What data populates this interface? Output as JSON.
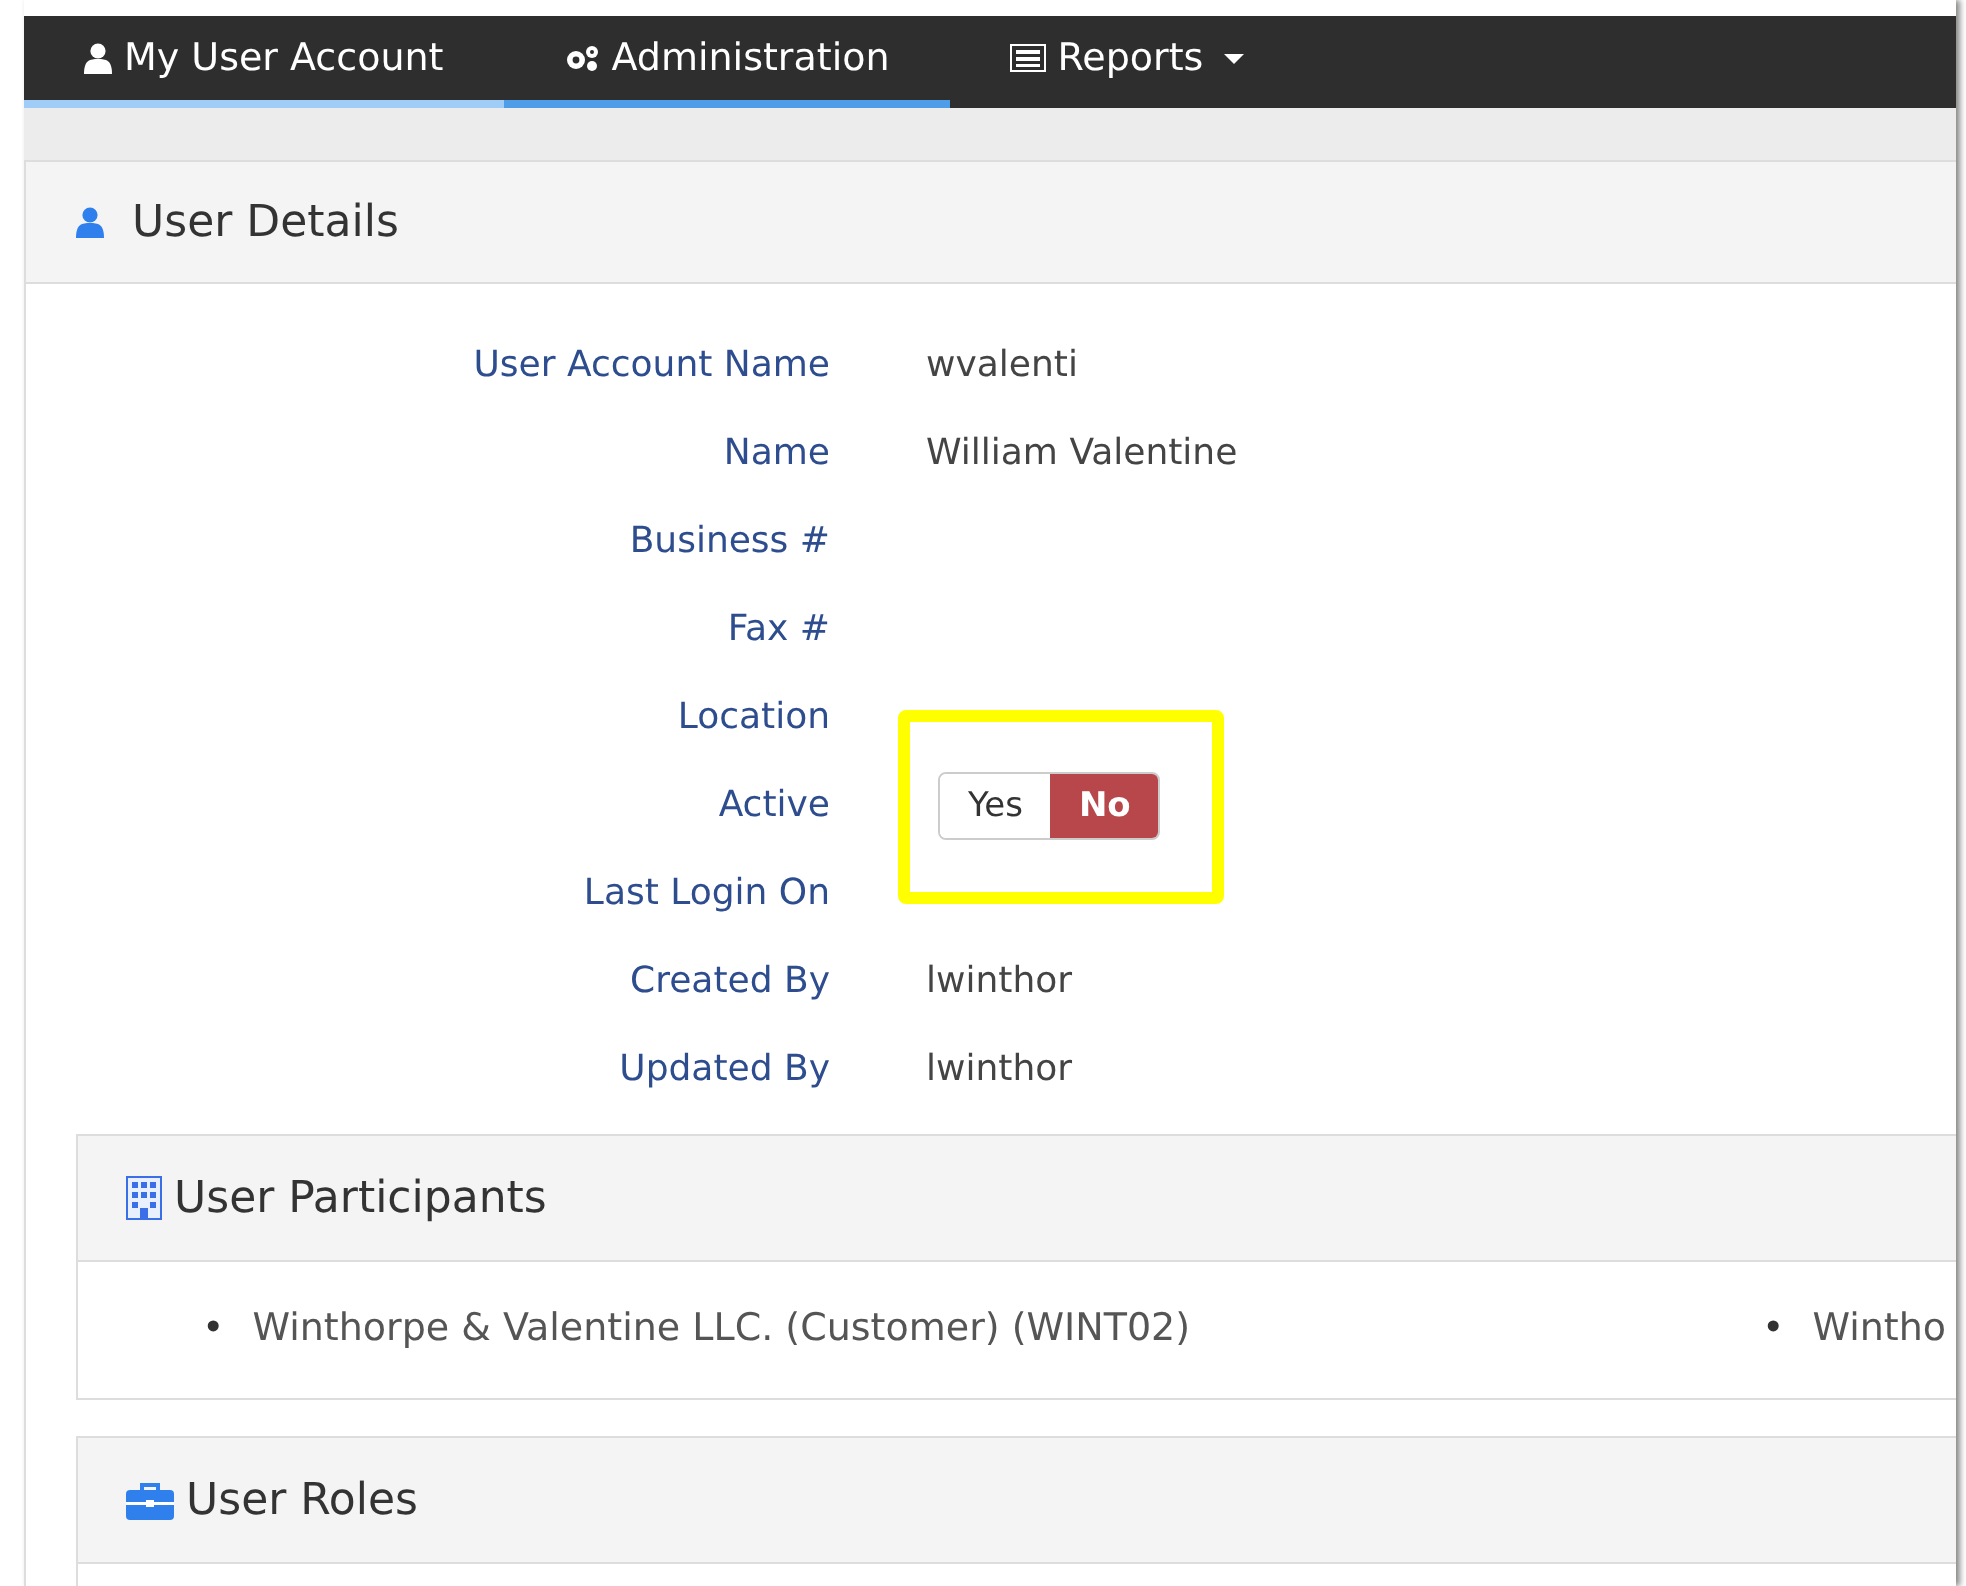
{
  "nav": {
    "tabs": [
      {
        "label": "My User Account",
        "selected": false
      },
      {
        "label": "Administration",
        "selected": true
      },
      {
        "label": "Reports",
        "selected": false,
        "dropdown": true
      }
    ]
  },
  "user_details": {
    "title": "User Details",
    "fields": [
      {
        "label": "User Account Name",
        "kind": "text",
        "value": "wvalenti"
      },
      {
        "label": "Name",
        "kind": "text",
        "value": "William Valentine"
      },
      {
        "label": "Business #",
        "kind": "text"
      },
      {
        "label": "Fax #",
        "kind": "text"
      },
      {
        "label": "Location",
        "kind": "text"
      },
      {
        "label": "Active",
        "kind": "toggle",
        "highlighted": true,
        "options": [
          {
            "label": "Yes",
            "selected": false
          },
          {
            "label": "No",
            "selected": true
          }
        ]
      },
      {
        "label": "Last Login On",
        "kind": "text"
      },
      {
        "label": "Created By",
        "kind": "text",
        "value": "lwinthor"
      },
      {
        "label": "Updated By",
        "kind": "text",
        "value": "lwinthor"
      }
    ]
  },
  "user_participants": {
    "title": "User Participants",
    "items": [
      {
        "marker": "•",
        "text": "Winthorpe & Valentine LLC. (Customer) (WINT02)"
      },
      {
        "marker": "•",
        "text": "Wintho"
      }
    ]
  },
  "user_roles": {
    "title": "User Roles"
  }
}
